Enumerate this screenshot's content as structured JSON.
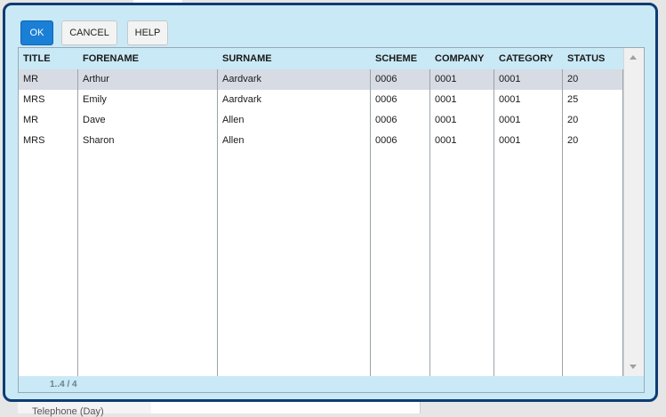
{
  "background": {
    "partial_label": "Telephone (Day)"
  },
  "toolbar": {
    "ok_label": "OK",
    "cancel_label": "CANCEL",
    "help_label": "HELP"
  },
  "grid": {
    "columns": [
      "TITLE",
      "FORENAME",
      "SURNAME",
      "SCHEME",
      "COMPANY",
      "CATEGORY",
      "STATUS"
    ],
    "rows": [
      [
        "MR",
        "Arthur",
        "Aardvark",
        "0006",
        "0001",
        "0001",
        "20"
      ],
      [
        "MRS",
        "Emily",
        "Aardvark",
        "0006",
        "0001",
        "0001",
        "25"
      ],
      [
        "MR",
        "Dave",
        "Allen",
        "0006",
        "0001",
        "0001",
        "20"
      ],
      [
        "MRS",
        "Sharon",
        "Allen",
        "0006",
        "0001",
        "0001",
        "20"
      ]
    ],
    "selected_row": 0,
    "pager": "1..4 / 4"
  },
  "colors": {
    "dialog_border": "#0f3b73",
    "dialog_background": "#c9e9f6",
    "ok_button": "#1a7fd6",
    "selected_row": "#d7dbe3"
  }
}
